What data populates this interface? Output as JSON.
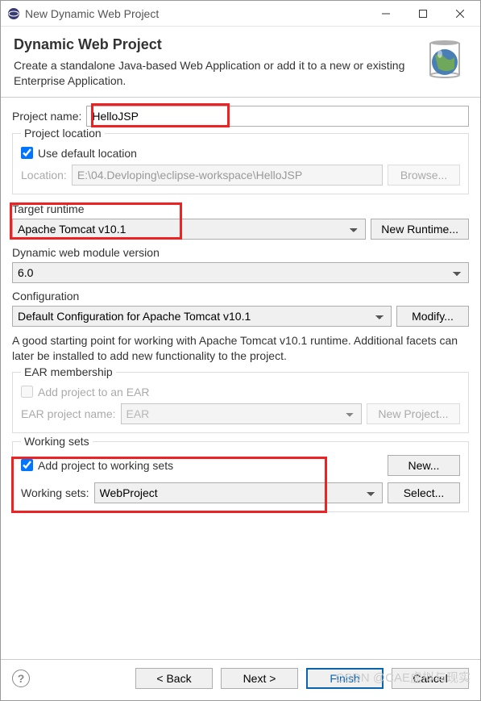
{
  "titlebar": {
    "title": "New Dynamic Web Project"
  },
  "header": {
    "title": "Dynamic Web Project",
    "subtitle": "Create a standalone Java-based Web Application or add it to a new or existing Enterprise Application."
  },
  "project_name": {
    "label": "Project name:",
    "value": "HelloJSP"
  },
  "project_location": {
    "legend": "Project location",
    "use_default_label": "Use default location",
    "use_default_checked": true,
    "location_label": "Location:",
    "location_value": "E:\\04.Devloping\\eclipse-workspace\\HelloJSP",
    "browse_label": "Browse..."
  },
  "target_runtime": {
    "title": "Target runtime",
    "value": "Apache Tomcat v10.1",
    "button": "New Runtime..."
  },
  "web_module": {
    "title": "Dynamic web module version",
    "value": "6.0"
  },
  "configuration": {
    "title": "Configuration",
    "value": "Default Configuration for Apache Tomcat v10.1",
    "button": "Modify...",
    "description": "A good starting point for working with Apache Tomcat v10.1 runtime. Additional facets can later be installed to add new functionality to the project."
  },
  "ear": {
    "legend": "EAR membership",
    "add_label": "Add project to an EAR",
    "add_checked": false,
    "name_label": "EAR project name:",
    "name_value": "EAR",
    "button": "New Project..."
  },
  "working_sets": {
    "legend": "Working sets",
    "add_label": "Add project to working sets",
    "add_checked": true,
    "new_button": "New...",
    "ws_label": "Working sets:",
    "ws_value": "WebProject",
    "select_button": "Select..."
  },
  "footer": {
    "back": "< Back",
    "next": "Next >",
    "finish": "Finish",
    "cancel": "Cancel"
  },
  "watermark": "CSDN @CAE虚拟与现实"
}
